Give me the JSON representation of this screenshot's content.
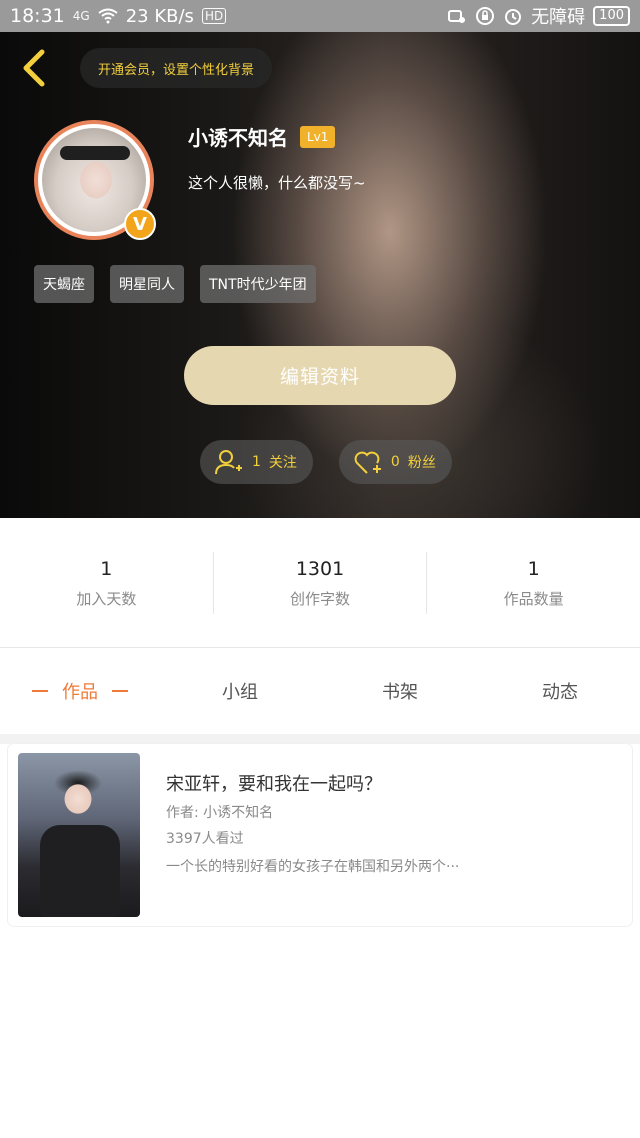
{
  "status_bar": {
    "time": "18:31",
    "network": "4G",
    "speed": "23 KB/s",
    "hd": "HD",
    "accessibility": "无障碍",
    "battery": "100"
  },
  "header": {
    "vip_prompt": "开通会员，设置个性化背景"
  },
  "profile": {
    "username": "小诱不知名",
    "level": "Lv1",
    "bio": "这个人很懒，什么都没写~",
    "badge": "V",
    "tags": [
      "天蝎座",
      "明星同人",
      "TNT时代少年团"
    ],
    "edit_button": "编辑资料",
    "following": {
      "count": "1",
      "label": "关注"
    },
    "followers": {
      "count": "0",
      "label": "粉丝"
    }
  },
  "stats": [
    {
      "value": "1",
      "label": "加入天数"
    },
    {
      "value": "1301",
      "label": "创作字数"
    },
    {
      "value": "1",
      "label": "作品数量"
    }
  ],
  "tabs": [
    {
      "label": "作品",
      "active": true
    },
    {
      "label": "小组",
      "active": false
    },
    {
      "label": "书架",
      "active": false
    },
    {
      "label": "动态",
      "active": false
    }
  ],
  "works": [
    {
      "title": "宋亚轩，要和我在一起吗？",
      "author": "作者:  小诱不知名",
      "views": "3397人看过",
      "description": "一个长的特别好看的女孩子在韩国和另外两个···"
    }
  ],
  "colors": {
    "accent_orange": "#f07a3a",
    "gold": "#f2cf3c",
    "edit_button": "#e5d7b0",
    "avatar_ring": "#e9845a"
  }
}
